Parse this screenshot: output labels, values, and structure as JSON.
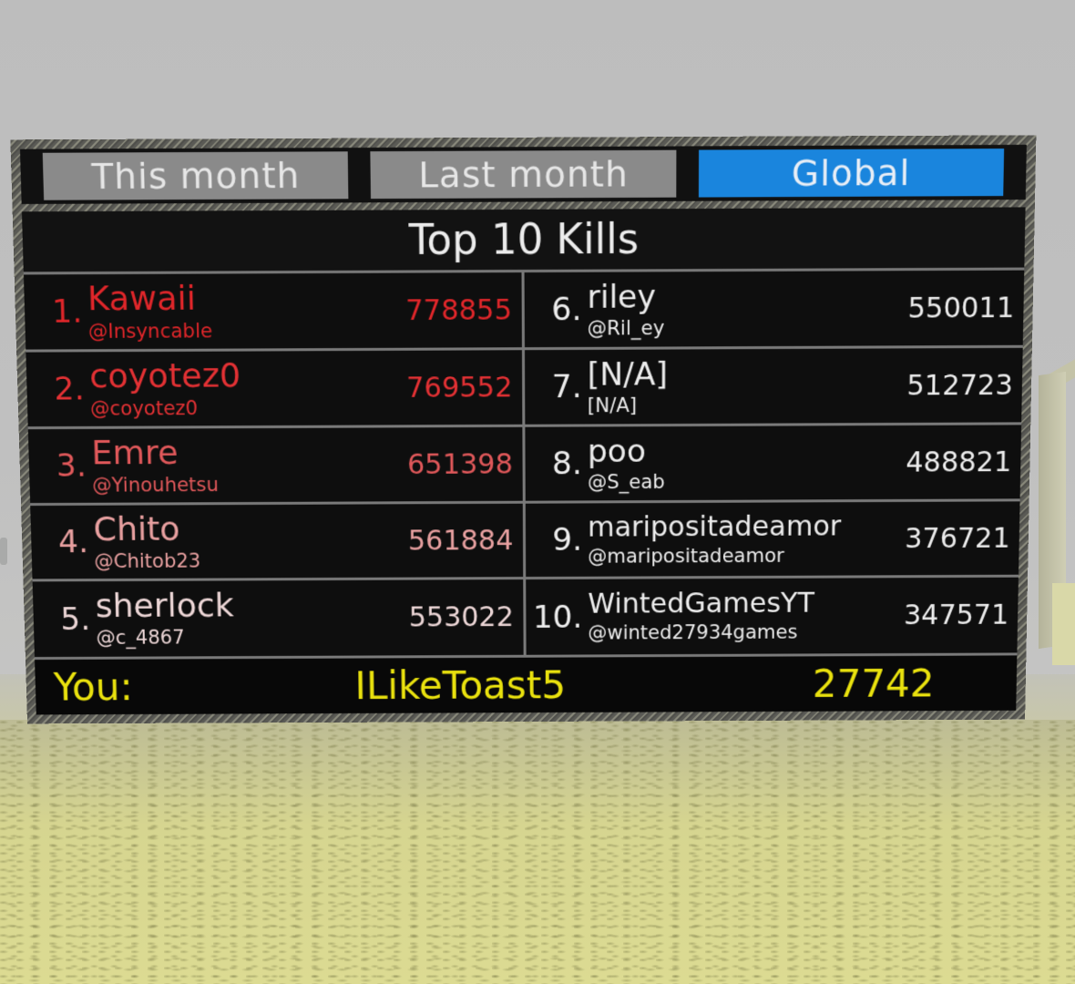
{
  "tabs": [
    {
      "label": "This month",
      "active": false
    },
    {
      "label": "Last month",
      "active": false
    },
    {
      "label": "Global",
      "active": true
    }
  ],
  "title": "Top 10 Kills",
  "leaderboard": {
    "left": [
      {
        "rank": "1.",
        "display_name": "Kawaii",
        "username": "@Insyncable",
        "kills": "778855"
      },
      {
        "rank": "2.",
        "display_name": "coyotez0",
        "username": "@coyotez0",
        "kills": "769552"
      },
      {
        "rank": "3.",
        "display_name": "Emre",
        "username": "@Yinouhetsu",
        "kills": "651398"
      },
      {
        "rank": "4.",
        "display_name": "Chito",
        "username": "@Chitob23",
        "kills": "561884"
      },
      {
        "rank": "5.",
        "display_name": "sherlock",
        "username": "@c_4867",
        "kills": "553022"
      }
    ],
    "right": [
      {
        "rank": "6.",
        "display_name": "riley",
        "username": "@Ril_ey",
        "kills": "550011"
      },
      {
        "rank": "7.",
        "display_name": "[N/A]",
        "username": "[N/A]",
        "kills": "512723"
      },
      {
        "rank": "8.",
        "display_name": "poo",
        "username": "@S_eab",
        "kills": "488821"
      },
      {
        "rank": "9.",
        "display_name": "maripositadeamor",
        "username": "@maripositadeamor",
        "kills": "376721"
      },
      {
        "rank": "10.",
        "display_name": "WintedGamesYT",
        "username": "@winted27934games",
        "kills": "347571"
      }
    ]
  },
  "you": {
    "label": "You:",
    "username": "ILikeToast5",
    "kills": "27742"
  },
  "colors": {
    "active_tab": "#1a85dd",
    "inactive_tab": "#8a8a8a",
    "rank1": "#e0262a",
    "rank3": "#e0585a",
    "rank4": "#e8a0a0",
    "rank5": "#ecd6d6",
    "you_text": "#e9e10e"
  }
}
